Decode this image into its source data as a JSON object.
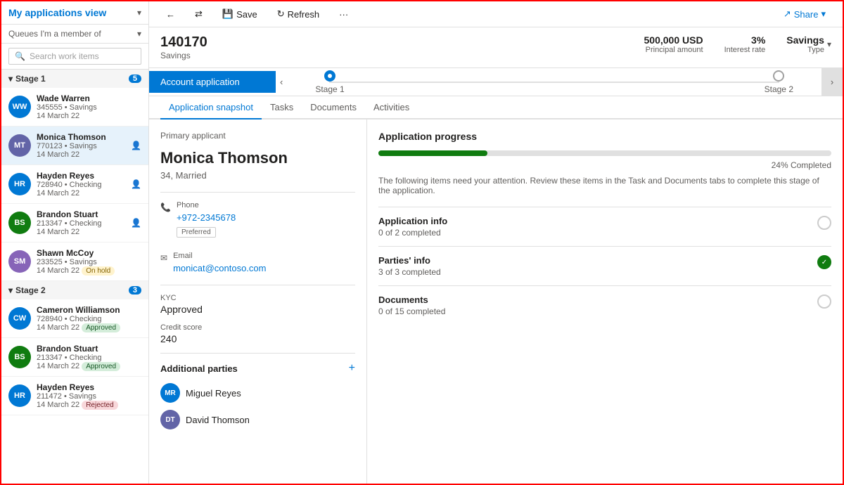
{
  "sidebar": {
    "title": "My applications view",
    "queues_label": "Queues I'm a member of",
    "search_placeholder": "Search work items",
    "stages": [
      {
        "label": "Stage 1",
        "count": "5",
        "items": [
          {
            "id": "ww",
            "initials": "WW",
            "name": "Wade Warren",
            "id_num": "345555",
            "type": "Savings",
            "date": "14 March 22",
            "color": "#0078d4",
            "badge": "",
            "assignable": false,
            "selected": false
          },
          {
            "id": "mt",
            "initials": "MT",
            "name": "Monica Thomson",
            "id_num": "770123",
            "type": "Savings",
            "date": "14 March 22",
            "color": "#6264a7",
            "badge": "",
            "assignable": true,
            "selected": true
          },
          {
            "id": "hr",
            "initials": "HR",
            "name": "Hayden Reyes",
            "id_num": "728940",
            "type": "Checking",
            "date": "14 March 22",
            "color": "#0078d4",
            "badge": "",
            "assignable": true,
            "selected": false
          },
          {
            "id": "bs",
            "initials": "BS",
            "name": "Brandon Stuart",
            "id_num": "213347",
            "type": "Checking",
            "date": "14 March 22",
            "color": "#107c10",
            "badge": "",
            "assignable": true,
            "selected": false
          },
          {
            "id": "sm",
            "initials": "SM",
            "name": "Shawn McCoy",
            "id_num": "233525",
            "type": "Savings",
            "date": "14 March 22",
            "color": "#8764b8",
            "badge": "On hold",
            "assignable": false,
            "selected": false
          }
        ]
      },
      {
        "label": "Stage 2",
        "count": "3",
        "items": [
          {
            "id": "cw",
            "initials": "CW",
            "name": "Cameron Williamson",
            "id_num": "728940",
            "type": "Checking",
            "date": "14 March 22",
            "color": "#0078d4",
            "badge": "Approved",
            "assignable": false,
            "selected": false
          },
          {
            "id": "bs2",
            "initials": "BS",
            "name": "Brandon Stuart",
            "id_num": "213347",
            "type": "Checking",
            "date": "14 March 22",
            "color": "#107c10",
            "badge": "Approved",
            "assignable": false,
            "selected": false
          },
          {
            "id": "hr2",
            "initials": "HR",
            "name": "Hayden Reyes",
            "id_num": "211472",
            "type": "Savings",
            "date": "14 March 22",
            "color": "#0078d4",
            "badge": "Rejected",
            "assignable": false,
            "selected": false
          }
        ]
      }
    ]
  },
  "toolbar": {
    "back_label": "←",
    "refresh_label": "Refresh",
    "save_label": "Save",
    "more_label": "···",
    "share_label": "Share"
  },
  "record": {
    "id": "140170",
    "subtitle": "Savings",
    "principal_amount": "500,000 USD",
    "principal_label": "Principal amount",
    "interest_rate": "3%",
    "interest_label": "Interest rate",
    "savings_type": "Savings",
    "savings_label": "Type"
  },
  "stage_bar": {
    "tab_label": "Account application",
    "stage1_label": "Stage 1",
    "stage2_label": "Stage 2"
  },
  "tabs": [
    {
      "id": "snapshot",
      "label": "Application snapshot",
      "active": true
    },
    {
      "id": "tasks",
      "label": "Tasks",
      "active": false
    },
    {
      "id": "documents",
      "label": "Documents",
      "active": false
    },
    {
      "id": "activities",
      "label": "Activities",
      "active": false
    }
  ],
  "primary_applicant": {
    "section_label": "Primary applicant",
    "name": "Monica Thomson",
    "detail": "34, Married",
    "phone_label": "Phone",
    "phone_value": "+972-2345678",
    "preferred_label": "Preferred",
    "email_label": "Email",
    "email_value": "monicat@contoso.com",
    "kyc_label": "KYC",
    "kyc_value": "Approved",
    "credit_label": "Credit score",
    "credit_value": "240"
  },
  "additional_parties": {
    "title": "Additional parties",
    "add_btn": "+",
    "parties": [
      {
        "initials": "MR",
        "name": "Miguel Reyes",
        "color": "#0078d4"
      },
      {
        "initials": "DT",
        "name": "David Thomson",
        "color": "#6264a7"
      }
    ]
  },
  "progress": {
    "title": "Application progress",
    "percent": 24,
    "percent_label": "24% Completed",
    "note": "The following items need your attention. Review these items in the Task and Documents tabs to complete this stage of the application.",
    "items": [
      {
        "name": "Application info",
        "sub": "0 of 2 completed",
        "complete": false
      },
      {
        "name": "Parties' info",
        "sub": "3 of 3 completed",
        "complete": true
      },
      {
        "name": "Documents",
        "sub": "0 of 15 completed",
        "complete": false
      }
    ]
  }
}
